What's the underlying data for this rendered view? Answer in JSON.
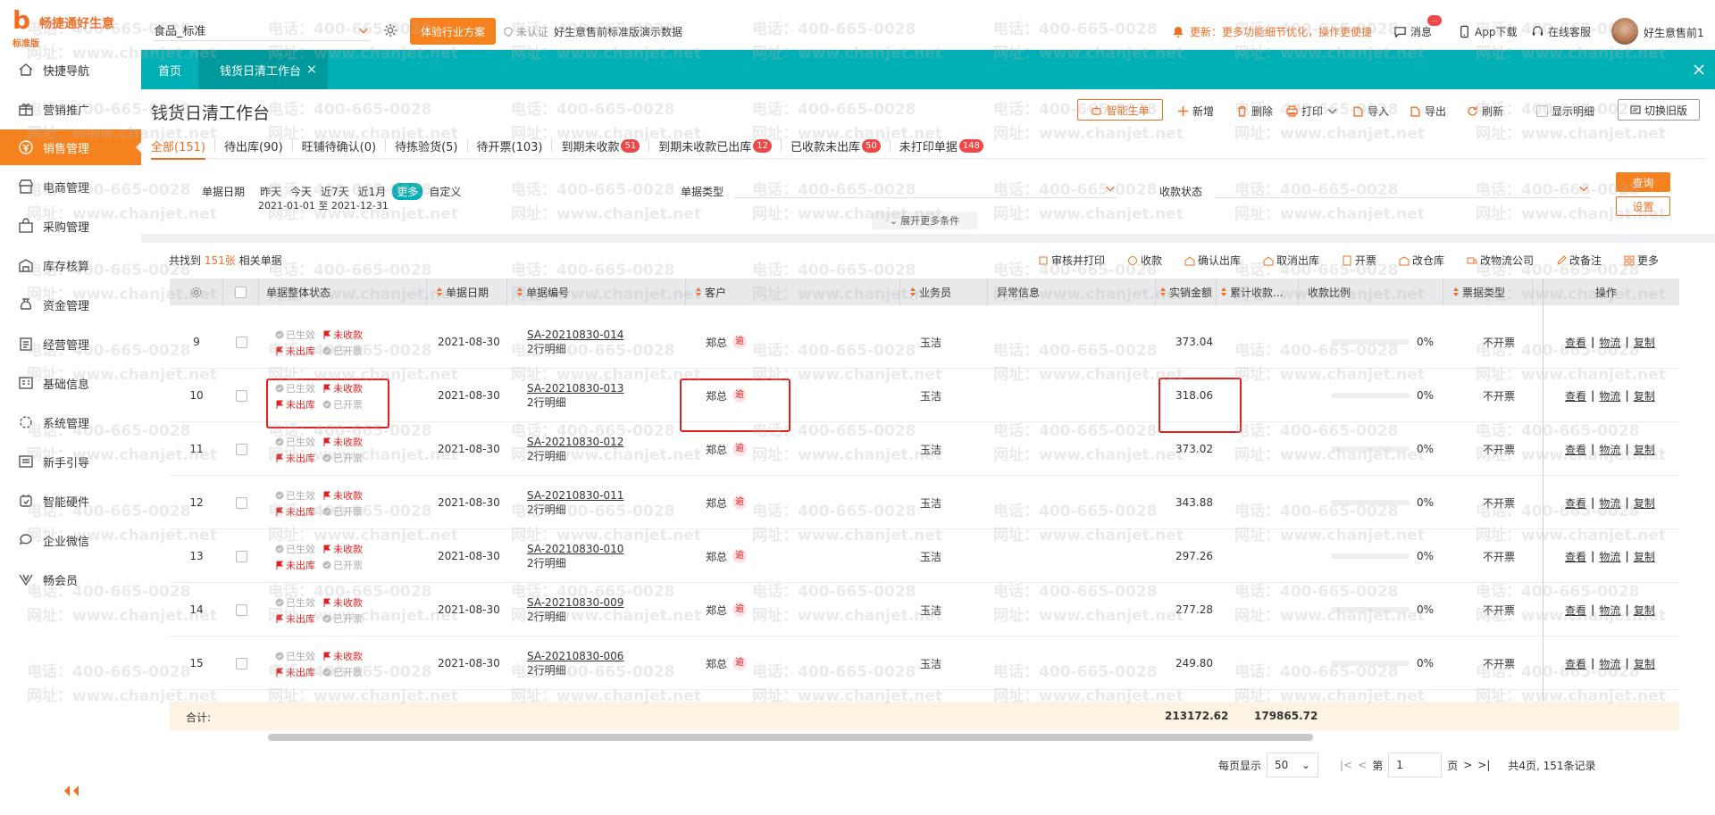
{
  "app": {
    "name": "畅捷通好生意",
    "edition": "标准版"
  },
  "topbar": {
    "account": "食品_标准",
    "trial_btn": "体验行业方案",
    "cert": "未认证",
    "demo": "好生意售前标准版演示数据",
    "notice": "更新：更多功能细节优化，操作更便捷",
    "messages": "消息",
    "msg_badge": "...",
    "app_download": "App下载",
    "support": "在线客服",
    "user": "好生意售前1"
  },
  "sidebar": {
    "items": [
      "快捷导航",
      "营销推广",
      "销售管理",
      "电商管理",
      "采购管理",
      "库存核算",
      "资金管理",
      "经营管理",
      "基础信息",
      "系统管理",
      "新手引导",
      "智能硬件",
      "企业微信",
      "畅会员"
    ]
  },
  "page_tabs": {
    "home": "首页",
    "current": "钱货日清工作台"
  },
  "page": {
    "title": "钱货日清工作台",
    "actions": {
      "smart": "智能生单",
      "add": "新增",
      "delete": "删除",
      "print": "打印",
      "import": "导入",
      "export": "导出",
      "refresh": "刷新",
      "show_detail": "显示明细",
      "old_version": "切换旧版"
    },
    "status_tabs": [
      {
        "label": "全部(151)"
      },
      {
        "label": "待出库(90)"
      },
      {
        "label": "旺铺待确认(0)"
      },
      {
        "label": "待拣验货(5)"
      },
      {
        "label": "待开票(103)"
      },
      {
        "label": "到期未收款",
        "count": "51"
      },
      {
        "label": "到期未收款已出库",
        "count": "12"
      },
      {
        "label": "已收款未出库",
        "count": "50"
      },
      {
        "label": "未打印单据",
        "count": "148"
      }
    ],
    "filters": {
      "date_label": "单据日期",
      "quick": [
        "昨天",
        "今天",
        "近7天",
        "近1月",
        "更多",
        "自定义"
      ],
      "date_range": "2021-01-01 至 2021-12-31",
      "type_label": "单据类型",
      "pay_label": "收款状态",
      "query": "查询",
      "settings": "设置",
      "expand": "展开更多条件"
    },
    "found": {
      "prefix": "共找到",
      "count": "151张",
      "suffix": "相关单据"
    },
    "table_actions": [
      "审核并打印",
      "收款",
      "确认出库",
      "取消出库",
      "开票",
      "改仓库",
      "改物流公司",
      "改备注",
      "更多"
    ],
    "columns": [
      "单据整体状态",
      "单据日期",
      "单据编号",
      "客户",
      "业务员",
      "异常信息",
      "实销金额",
      "累计收款...",
      "收款比例",
      "票据类型",
      "操作"
    ],
    "status_words": {
      "effective": "已生效",
      "unpaid": "未收款",
      "unshipped": "未出库",
      "invoiced": "已开票"
    },
    "rows": [
      {
        "no": "9",
        "date": "2021-08-30",
        "code": "SA-20210830-014",
        "detail": "2行明细",
        "customer": "郑总",
        "overdue": "逾",
        "staff": "玉洁",
        "amount": "373.04",
        "ratio": "0%",
        "ticket": "不开票"
      },
      {
        "no": "10",
        "date": "2021-08-30",
        "code": "SA-20210830-013",
        "detail": "2行明细",
        "customer": "郑总",
        "overdue": "逾",
        "staff": "玉洁",
        "amount": "318.06",
        "ratio": "0%",
        "ticket": "不开票"
      },
      {
        "no": "11",
        "date": "2021-08-30",
        "code": "SA-20210830-012",
        "detail": "2行明细",
        "customer": "郑总",
        "overdue": "逾",
        "staff": "玉洁",
        "amount": "373.02",
        "ratio": "0%",
        "ticket": "不开票"
      },
      {
        "no": "12",
        "date": "2021-08-30",
        "code": "SA-20210830-011",
        "detail": "2行明细",
        "customer": "郑总",
        "overdue": "逾",
        "staff": "玉洁",
        "amount": "343.88",
        "ratio": "0%",
        "ticket": "不开票"
      },
      {
        "no": "13",
        "date": "2021-08-30",
        "code": "SA-20210830-010",
        "detail": "2行明细",
        "customer": "郑总",
        "overdue": "逾",
        "staff": "玉洁",
        "amount": "297.26",
        "ratio": "0%",
        "ticket": "不开票"
      },
      {
        "no": "14",
        "date": "2021-08-30",
        "code": "SA-20210830-009",
        "detail": "2行明细",
        "customer": "郑总",
        "overdue": "逾",
        "staff": "玉洁",
        "amount": "277.28",
        "ratio": "0%",
        "ticket": "不开票"
      },
      {
        "no": "15",
        "date": "2021-08-30",
        "code": "SA-20210830-006",
        "detail": "2行明细",
        "customer": "郑总",
        "overdue": "逾",
        "staff": "玉洁",
        "amount": "249.80",
        "ratio": "0%",
        "ticket": "不开票"
      }
    ],
    "row_ops": [
      "查看",
      "物流",
      "复制"
    ],
    "totals": {
      "label": "合计:",
      "amount": "213172.62",
      "received": "179865.72"
    },
    "pager": {
      "per_page_label": "每页显示",
      "per_page": "50",
      "page_prefix": "第",
      "page": "1",
      "page_suffix": "页",
      "summary": "共4页, 151条记录"
    }
  },
  "watermark": {
    "phone": "电话：400-665-0028",
    "site": "网址：www.chanjet.net"
  },
  "colors": {
    "brand": "#f5821f",
    "teal": "#00b0b4",
    "danger": "#e02020"
  }
}
